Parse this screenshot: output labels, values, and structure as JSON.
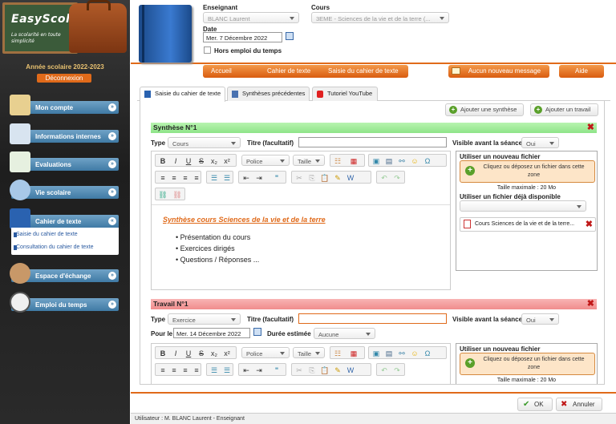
{
  "sidebar": {
    "logo_title": "EasyScol",
    "logo_tagline": "La scolarité en toute simplicité",
    "year": "Année scolaire 2022-2023",
    "logout": "Déconnexion",
    "items": [
      {
        "label": "Mon compte",
        "icon": "pencil-notebook-icon"
      },
      {
        "label": "Informations internes",
        "icon": "newspaper-icon"
      },
      {
        "label": "Evaluations",
        "icon": "papers-icon"
      },
      {
        "label": "Vie scolaire",
        "icon": "globe-pen-icon"
      },
      {
        "label": "Cahier de texte",
        "icon": "book-icon"
      },
      {
        "label": "Espace d'échange",
        "icon": "people-icon"
      },
      {
        "label": "Emploi du temps",
        "icon": "clock-icon"
      }
    ],
    "sub_items": [
      "Saisie du cahier de texte",
      "Consultation du cahier de texte"
    ]
  },
  "header": {
    "enseignant_label": "Enseignant",
    "enseignant_value": "BLANC Laurent",
    "cours_label": "Cours",
    "cours_value": "3EME - Sciences de la vie et de la terre (...",
    "date_label": "Date",
    "date_value": "Mer. 7 Décembre 2022",
    "hors_label": "Hors emploi du temps"
  },
  "breadcrumb": [
    "Accueil",
    "Cahier de texte",
    "Saisie du cahier de texte"
  ],
  "message_btn": "Aucun nouveau message",
  "aide_btn": "Aide",
  "tabs": [
    "Saisie du cahier de texte",
    "Synthèses précédentes",
    "Tutoriel YouTube"
  ],
  "actions": {
    "add_synthese": "Ajouter une synthèse",
    "add_travail": "Ajouter un travail"
  },
  "synthese": {
    "title": "Synthèse N°1",
    "type_label": "Type",
    "type_value": "Cours",
    "titre_label": "Titre (facultatif)",
    "visible_label": "Visible avant la séance",
    "visible_value": "Oui",
    "police": "Police",
    "taille": "Taille",
    "content_title": "Synthèse cours Sciences de la vie et de la terre",
    "bullets": [
      "Présentation du cours",
      "Exercices dirigés",
      "Questions / Réponses ..."
    ],
    "upload_new": "Utiliser un nouveau fichier",
    "drop_text": "Cliquez ou déposez un fichier dans cette zone",
    "max_size": "Taille maximale : 20 Mo",
    "upload_existing": "Utiliser un fichier déjà disponible",
    "file_name": "Cours Sciences de la vie et de la terre..."
  },
  "travail": {
    "title": "Travail N°1",
    "type_label": "Type",
    "type_value": "Exercice",
    "titre_label": "Titre (facultatif)",
    "visible_label": "Visible avant la séance",
    "visible_value": "Oui",
    "pour_le_label": "Pour le",
    "pour_le_value": "Mer. 14 Décembre 2022",
    "duree_label": "Durée estimée",
    "duree_value": "Aucune",
    "police": "Police",
    "taille": "Taille",
    "upload_new": "Utiliser un nouveau fichier",
    "drop_text": "Cliquez ou déposez un fichier dans cette zone",
    "max_size": "Taille maximale : 20 Mo"
  },
  "footer": {
    "ok": "OK",
    "cancel": "Annuler"
  },
  "status": "Utilisateur : M. BLANC Laurent - Enseignant",
  "colors": {
    "accent": "#e06a1a",
    "nav": "#3f7aa5",
    "synthese_bar": "#a8f0a0",
    "travail_bar": "#f6a0a0"
  }
}
